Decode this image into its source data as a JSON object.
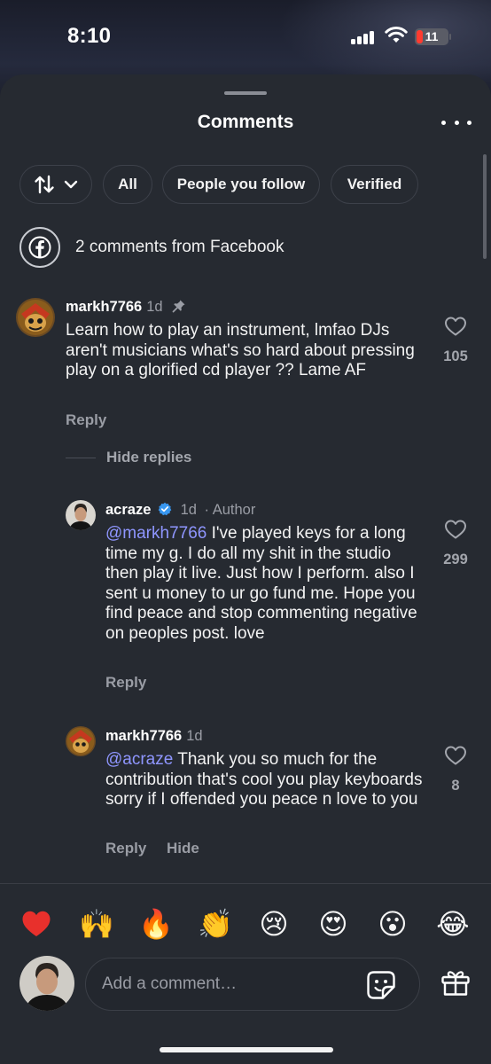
{
  "status_bar": {
    "time": "8:10",
    "battery": "11"
  },
  "header": {
    "title": "Comments"
  },
  "filters": {
    "all": "All",
    "people_you_follow": "People you follow",
    "verified": "Verified"
  },
  "facebook": {
    "text": "2 comments from Facebook"
  },
  "comments": [
    {
      "username": "markh7766",
      "age": "1d",
      "text": "Learn how to play an instrument, lmfao DJs aren't musicians what's so hard about pressing play on a glorified cd player ?? Lame AF",
      "likes": "105",
      "reply_label": "Reply",
      "hide_replies_label": "Hide replies",
      "replies": [
        {
          "username": "acraze",
          "age": "1d",
          "author_label": "· Author",
          "mention": "@markh7766",
          "text": " I've played keys for a long time my g. I do all my shit in the studio then play it live. Just how I perform. also I sent u money to ur go fund me. Hope you find peace and stop commenting negative on peoples post. love",
          "likes": "299",
          "reply_label": "Reply"
        },
        {
          "username": "markh7766",
          "age": "1d",
          "mention": "@acraze",
          "text": " Thank you so much for the contribution that's cool you play keyboards sorry if I offended you peace n love to you",
          "likes": "8",
          "reply_label": "Reply",
          "hide_label": "Hide"
        }
      ]
    }
  ],
  "reactions": [
    "❤️",
    "🙌",
    "🔥",
    "👏",
    "😢",
    "😍",
    "😮",
    "😂"
  ],
  "composer": {
    "placeholder": "Add a comment…"
  },
  "colors": {
    "sheet": "#262a31",
    "mention": "#8f96ff",
    "muted": "#9a9da5",
    "verified_badge": "#3897f0"
  }
}
